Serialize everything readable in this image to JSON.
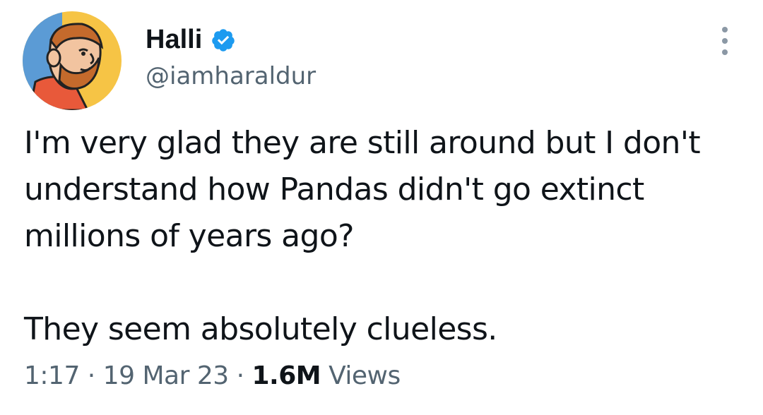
{
  "author": {
    "display_name": "Halli",
    "handle": "@iamharaldur",
    "verified": true,
    "avatar_icon": "cartoon-avatar",
    "verified_icon": "verified-badge-icon",
    "more_icon": "more-options-icon"
  },
  "tweet": {
    "lines": [
      "I'm very glad they are still around but I don't",
      "understand how Pandas didn't go extinct",
      "millions of years ago?",
      "They seem absolutely clueless."
    ]
  },
  "meta": {
    "time": "1:17",
    "separator": "·",
    "date": "19 Mar 23",
    "views_count": "1.6M",
    "views_label": "Views"
  },
  "colors": {
    "text": "#0f1419",
    "secondary": "#536471",
    "verified_blue": "#1d9bf0",
    "avatar_bg": "#f6c445"
  }
}
